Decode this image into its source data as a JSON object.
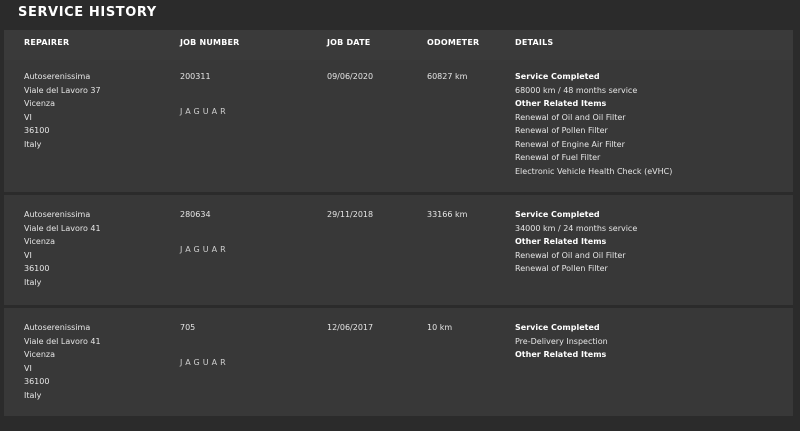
{
  "page": {
    "title": "SERVICE HISTORY"
  },
  "headers": {
    "repairer": "REPAIRER",
    "job_number": "JOB NUMBER",
    "job_date": "JOB DATE",
    "odometer": "ODOMETER",
    "details": "DETAILS"
  },
  "records": [
    {
      "repairer": [
        "Autoserenissima",
        "Viale del Lavoro 37",
        "Vicenza",
        "VI",
        "36100",
        "Italy"
      ],
      "job_number": "200311",
      "brand": "JAGUAR",
      "job_date": "09/06/2020",
      "odometer": "60827 km",
      "service_completed_label": "Service Completed",
      "service_completed": "68000 km / 48 months service",
      "other_label": "Other Related Items",
      "other_items": [
        "Renewal of Oil and Oil Filter",
        "Renewal of Pollen Filter",
        "Renewal of Engine Air Filter",
        "Renewal of Fuel Filter",
        "Electronic Vehicle Health Check (eVHC)"
      ]
    },
    {
      "repairer": [
        "Autoserenissima",
        "Viale del Lavoro 41",
        "Vicenza",
        "VI",
        "36100",
        "Italy"
      ],
      "job_number": "280634",
      "brand": "JAGUAR",
      "job_date": "29/11/2018",
      "odometer": "33166 km",
      "service_completed_label": "Service Completed",
      "service_completed": "34000 km / 24 months service",
      "other_label": "Other Related Items",
      "other_items": [
        "Renewal of Oil and Oil Filter",
        "Renewal of Pollen Filter"
      ]
    },
    {
      "repairer": [
        "Autoserenissima",
        "Viale del Lavoro 41",
        "Vicenza",
        "VI",
        "36100",
        "Italy"
      ],
      "job_number": "705",
      "brand": "JAGUAR",
      "job_date": "12/06/2017",
      "odometer": "10 km",
      "service_completed_label": "Service Completed",
      "service_completed": "Pre-Delivery Inspection",
      "other_label": "Other Related Items",
      "other_items": []
    }
  ]
}
